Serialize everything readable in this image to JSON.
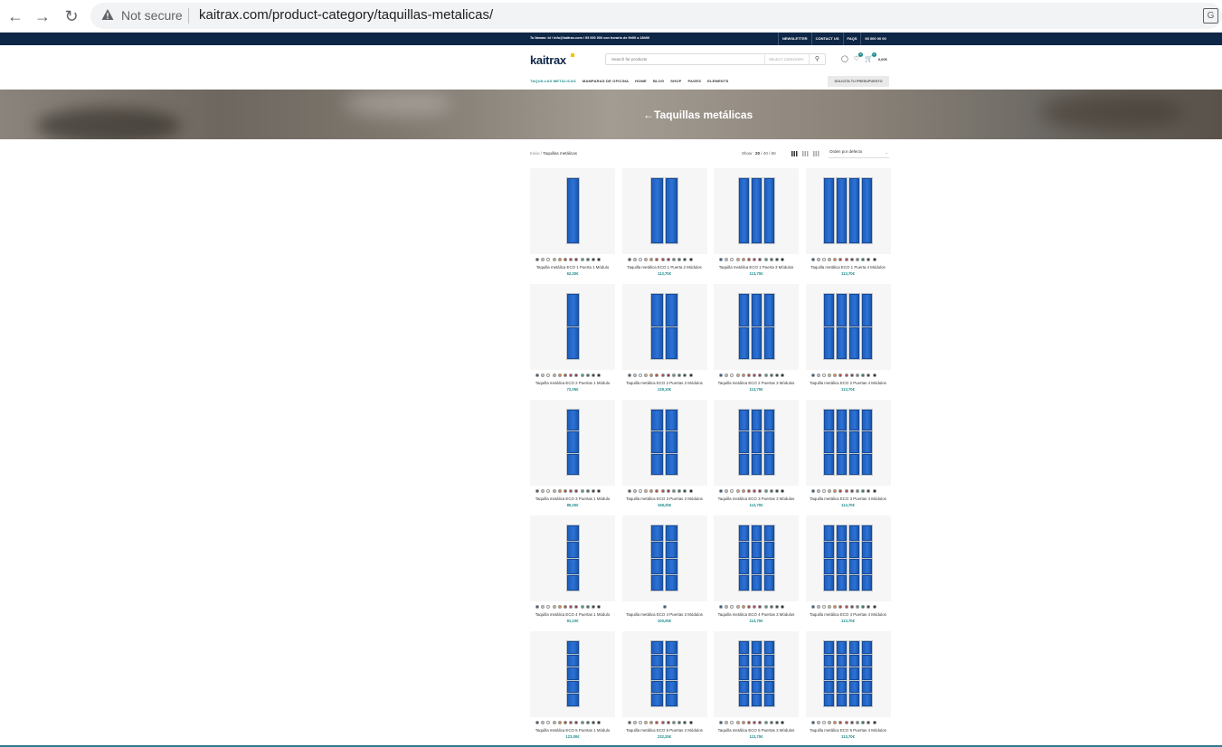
{
  "browser": {
    "security": "Not secure",
    "url": "kaitrax.com/product-category/taquillas-metalicas/"
  },
  "topbar": {
    "message": "Tu llamas: bi  / info@kaitrax.com / 93 000 000 con horario de 9h00 a 18h00",
    "links": [
      "NEWSLETTER",
      "CONTACT US",
      "FAQS",
      "93 000 00 00"
    ]
  },
  "header": {
    "logo": "kaitrax",
    "search_placeholder": "Search for products",
    "search_category": "SELECT CATEGORY",
    "cart_total": "0,00€",
    "wishlist_count": "0",
    "cart_count": "0"
  },
  "nav": {
    "items": [
      "TAQUILLAS METÁLICAS",
      "MAMPARAS DE OFICINA",
      "HOME",
      "BLOG",
      "SHOP",
      "PAGES",
      "ELEMENTS"
    ],
    "quote_button": "SOLICITA TU PRESUPUESTO"
  },
  "hero": {
    "title": "Taquillas metálicas"
  },
  "toolbar": {
    "breadcrumb_home": "Inicio",
    "breadcrumb_current": "Taquillas metálicas",
    "show_label": "Show :",
    "show_options": [
      "20",
      "40",
      "60"
    ],
    "orderby": "Orden por defecto"
  },
  "swatch_colors": [
    "#1f4f7a",
    "#c9c9c9",
    "#ffffff",
    "#d8b58a",
    "#e28a3a",
    "#c0392b",
    "#b5384c",
    "#7a2c3a",
    "#4a9a7c",
    "#2f6b4f",
    "#1c3d2c",
    "#111111"
  ],
  "products": [
    {
      "name": "Taquilla metálica ECO 1 Puerta 1 Módulo",
      "price": "62,30€",
      "cols": 1,
      "rows": 1,
      "single_swatch": false
    },
    {
      "name": "Taquilla metálica ECO 1 Puerta 2 Módulos",
      "price": "113,70€",
      "cols": 2,
      "rows": 1,
      "single_swatch": false
    },
    {
      "name": "Taquilla metálica ECO 1 Puerta 3 Módulos",
      "price": "113,70€",
      "cols": 3,
      "rows": 1,
      "single_swatch": false
    },
    {
      "name": "Taquilla metálica ECO 1 Puerta 4 Módulos",
      "price": "113,70€",
      "cols": 4,
      "rows": 1,
      "single_swatch": false
    },
    {
      "name": "Taquilla metálica ECO 2 Puertas 1 Módulo",
      "price": "72,05€",
      "cols": 1,
      "rows": 2,
      "single_swatch": false
    },
    {
      "name": "Taquilla metálica ECO 2 Puertas 2 Módulos",
      "price": "128,10€",
      "cols": 2,
      "rows": 2,
      "single_swatch": false
    },
    {
      "name": "Taquilla metálica ECO 2 Puertas 3 Módulos",
      "price": "113,70€",
      "cols": 3,
      "rows": 2,
      "single_swatch": false
    },
    {
      "name": "Taquilla metálica ECO 2 Puertas 4 Módulos",
      "price": "113,70€",
      "cols": 4,
      "rows": 2,
      "single_swatch": false
    },
    {
      "name": "Taquilla metálica ECO 3 Puertas 1 Módulo",
      "price": "85,25€",
      "cols": 1,
      "rows": 3,
      "single_swatch": false
    },
    {
      "name": "Taquilla metálica ECO 3 Puertas 2 Módulos",
      "price": "158,20€",
      "cols": 2,
      "rows": 3,
      "single_swatch": false
    },
    {
      "name": "Taquilla metálica ECO 3 Puertas 3 Módulos",
      "price": "113,70€",
      "cols": 3,
      "rows": 3,
      "single_swatch": false
    },
    {
      "name": "Taquilla metálica ECO 3 Puertas 4 Módulos",
      "price": "113,70€",
      "cols": 4,
      "rows": 3,
      "single_swatch": false
    },
    {
      "name": "Taquilla metálica ECO 4 Puertas 1 Módulo",
      "price": "91,10€",
      "cols": 1,
      "rows": 4,
      "single_swatch": false
    },
    {
      "name": "Taquilla metálica ECO 4 Puertas 2 Módulos",
      "price": "100,00€",
      "cols": 2,
      "rows": 4,
      "single_swatch": true
    },
    {
      "name": "Taquilla metálica ECO 4 Puertas 3 Módulos",
      "price": "113,70€",
      "cols": 3,
      "rows": 4,
      "single_swatch": false
    },
    {
      "name": "Taquilla metálica ECO 4 Puertas 4 Módulos",
      "price": "113,70€",
      "cols": 4,
      "rows": 4,
      "single_swatch": false
    },
    {
      "name": "Taquilla metálica ECO 5 Puertas 1 Módulo",
      "price": "123,00€",
      "cols": 1,
      "rows": 5,
      "single_swatch": false
    },
    {
      "name": "Taquilla metálica ECO 5 Puertas 2 Módulos",
      "price": "232,20€",
      "cols": 2,
      "rows": 5,
      "single_swatch": false
    },
    {
      "name": "Taquilla metálica ECO 5 Puertas 3 Módulos",
      "price": "113,70€",
      "cols": 3,
      "rows": 5,
      "single_swatch": false
    },
    {
      "name": "Taquilla metálica ECO 5 Puertas 4 Módulos",
      "price": "113,70€",
      "cols": 4,
      "rows": 5,
      "single_swatch": false
    }
  ]
}
